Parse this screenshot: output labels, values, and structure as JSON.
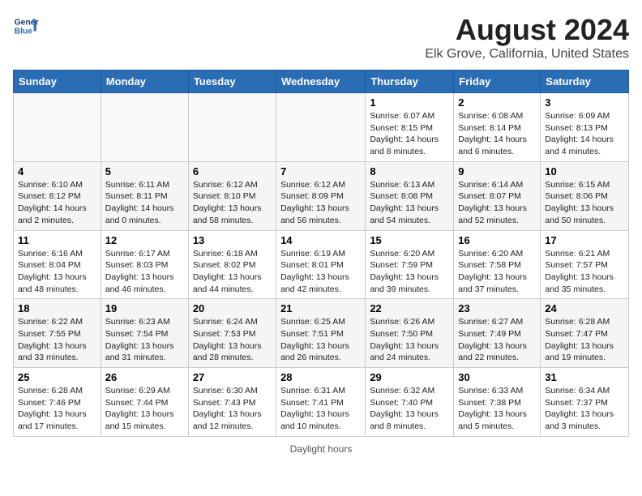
{
  "header": {
    "logo_line1": "General",
    "logo_line2": "Blue",
    "title": "August 2024",
    "subtitle": "Elk Grove, California, United States"
  },
  "days_of_week": [
    "Sunday",
    "Monday",
    "Tuesday",
    "Wednesday",
    "Thursday",
    "Friday",
    "Saturday"
  ],
  "footer": {
    "daylight_label": "Daylight hours"
  },
  "weeks": [
    [
      {
        "day": "",
        "info": ""
      },
      {
        "day": "",
        "info": ""
      },
      {
        "day": "",
        "info": ""
      },
      {
        "day": "",
        "info": ""
      },
      {
        "day": "1",
        "info": "Sunrise: 6:07 AM\nSunset: 8:15 PM\nDaylight: 14 hours\nand 8 minutes."
      },
      {
        "day": "2",
        "info": "Sunrise: 6:08 AM\nSunset: 8:14 PM\nDaylight: 14 hours\nand 6 minutes."
      },
      {
        "day": "3",
        "info": "Sunrise: 6:09 AM\nSunset: 8:13 PM\nDaylight: 14 hours\nand 4 minutes."
      }
    ],
    [
      {
        "day": "4",
        "info": "Sunrise: 6:10 AM\nSunset: 8:12 PM\nDaylight: 14 hours\nand 2 minutes."
      },
      {
        "day": "5",
        "info": "Sunrise: 6:11 AM\nSunset: 8:11 PM\nDaylight: 14 hours\nand 0 minutes."
      },
      {
        "day": "6",
        "info": "Sunrise: 6:12 AM\nSunset: 8:10 PM\nDaylight: 13 hours\nand 58 minutes."
      },
      {
        "day": "7",
        "info": "Sunrise: 6:12 AM\nSunset: 8:09 PM\nDaylight: 13 hours\nand 56 minutes."
      },
      {
        "day": "8",
        "info": "Sunrise: 6:13 AM\nSunset: 8:08 PM\nDaylight: 13 hours\nand 54 minutes."
      },
      {
        "day": "9",
        "info": "Sunrise: 6:14 AM\nSunset: 8:07 PM\nDaylight: 13 hours\nand 52 minutes."
      },
      {
        "day": "10",
        "info": "Sunrise: 6:15 AM\nSunset: 8:06 PM\nDaylight: 13 hours\nand 50 minutes."
      }
    ],
    [
      {
        "day": "11",
        "info": "Sunrise: 6:16 AM\nSunset: 8:04 PM\nDaylight: 13 hours\nand 48 minutes."
      },
      {
        "day": "12",
        "info": "Sunrise: 6:17 AM\nSunset: 8:03 PM\nDaylight: 13 hours\nand 46 minutes."
      },
      {
        "day": "13",
        "info": "Sunrise: 6:18 AM\nSunset: 8:02 PM\nDaylight: 13 hours\nand 44 minutes."
      },
      {
        "day": "14",
        "info": "Sunrise: 6:19 AM\nSunset: 8:01 PM\nDaylight: 13 hours\nand 42 minutes."
      },
      {
        "day": "15",
        "info": "Sunrise: 6:20 AM\nSunset: 7:59 PM\nDaylight: 13 hours\nand 39 minutes."
      },
      {
        "day": "16",
        "info": "Sunrise: 6:20 AM\nSunset: 7:58 PM\nDaylight: 13 hours\nand 37 minutes."
      },
      {
        "day": "17",
        "info": "Sunrise: 6:21 AM\nSunset: 7:57 PM\nDaylight: 13 hours\nand 35 minutes."
      }
    ],
    [
      {
        "day": "18",
        "info": "Sunrise: 6:22 AM\nSunset: 7:55 PM\nDaylight: 13 hours\nand 33 minutes."
      },
      {
        "day": "19",
        "info": "Sunrise: 6:23 AM\nSunset: 7:54 PM\nDaylight: 13 hours\nand 31 minutes."
      },
      {
        "day": "20",
        "info": "Sunrise: 6:24 AM\nSunset: 7:53 PM\nDaylight: 13 hours\nand 28 minutes."
      },
      {
        "day": "21",
        "info": "Sunrise: 6:25 AM\nSunset: 7:51 PM\nDaylight: 13 hours\nand 26 minutes."
      },
      {
        "day": "22",
        "info": "Sunrise: 6:26 AM\nSunset: 7:50 PM\nDaylight: 13 hours\nand 24 minutes."
      },
      {
        "day": "23",
        "info": "Sunrise: 6:27 AM\nSunset: 7:49 PM\nDaylight: 13 hours\nand 22 minutes."
      },
      {
        "day": "24",
        "info": "Sunrise: 6:28 AM\nSunset: 7:47 PM\nDaylight: 13 hours\nand 19 minutes."
      }
    ],
    [
      {
        "day": "25",
        "info": "Sunrise: 6:28 AM\nSunset: 7:46 PM\nDaylight: 13 hours\nand 17 minutes."
      },
      {
        "day": "26",
        "info": "Sunrise: 6:29 AM\nSunset: 7:44 PM\nDaylight: 13 hours\nand 15 minutes."
      },
      {
        "day": "27",
        "info": "Sunrise: 6:30 AM\nSunset: 7:43 PM\nDaylight: 13 hours\nand 12 minutes."
      },
      {
        "day": "28",
        "info": "Sunrise: 6:31 AM\nSunset: 7:41 PM\nDaylight: 13 hours\nand 10 minutes."
      },
      {
        "day": "29",
        "info": "Sunrise: 6:32 AM\nSunset: 7:40 PM\nDaylight: 13 hours\nand 8 minutes."
      },
      {
        "day": "30",
        "info": "Sunrise: 6:33 AM\nSunset: 7:38 PM\nDaylight: 13 hours\nand 5 minutes."
      },
      {
        "day": "31",
        "info": "Sunrise: 6:34 AM\nSunset: 7:37 PM\nDaylight: 13 hours\nand 3 minutes."
      }
    ]
  ]
}
